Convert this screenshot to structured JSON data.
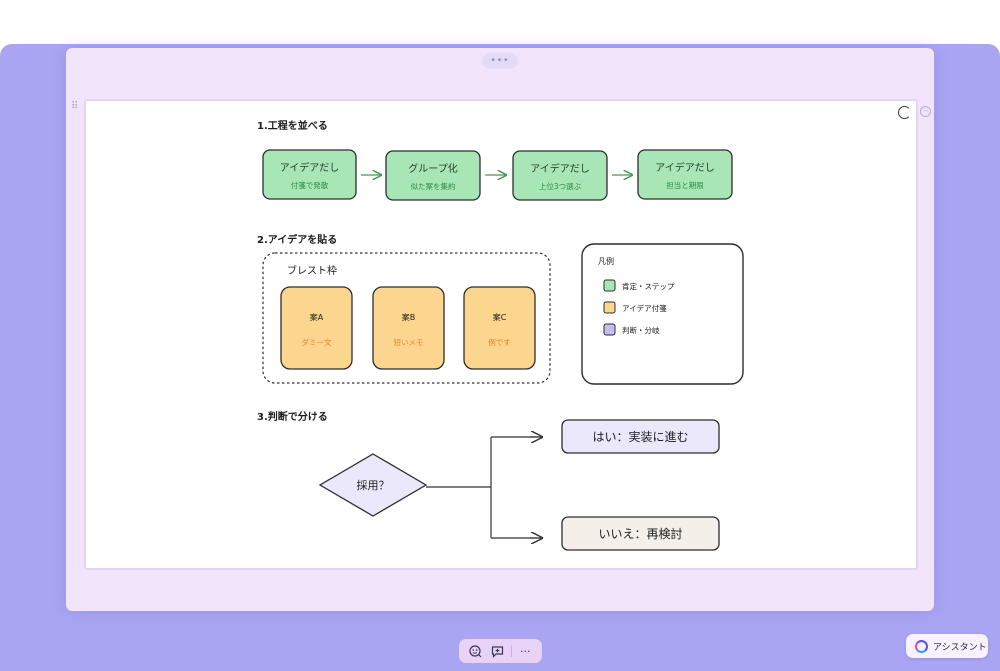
{
  "window": {
    "handle_dots": "•••"
  },
  "sections": {
    "s1": "1.工程を並べる",
    "s2": "2.アイデアを貼る",
    "s3": "3.判断で分ける"
  },
  "steps": [
    {
      "title": "アイデアだし",
      "sub": "付箋で発散"
    },
    {
      "title": "グループ化",
      "sub": "似た案を集約"
    },
    {
      "title": "アイデアだし",
      "sub": "上位3つ選ぶ"
    },
    {
      "title": "アイデアだし",
      "sub": "担当と期限"
    }
  ],
  "brainstorm": {
    "label": "ブレスト枠",
    "cards": [
      {
        "title": "案A",
        "sub": "ダミー文"
      },
      {
        "title": "案B",
        "sub": "短いメモ"
      },
      {
        "title": "案C",
        "sub": "例です"
      }
    ]
  },
  "legend": {
    "title": "凡例",
    "items": [
      {
        "label": "肯定・ステップ",
        "color": "#a8e6b6"
      },
      {
        "label": "アイデア付箋",
        "color": "#fcd68f"
      },
      {
        "label": "判断・分岐",
        "color": "#c3bdf2"
      }
    ]
  },
  "decision": {
    "question": "採用？",
    "yes": "はい：実装に進む",
    "no": "いいえ：再検討"
  },
  "colors": {
    "step_fill": "#a8e6b6",
    "step_text_sub": "#2f8a46",
    "note_fill": "#fcd68f",
    "note_sub": "#e8822a",
    "decision_fill": "#ebe8fb",
    "yes_fill": "#ebe8fb",
    "no_fill": "#f4efe8",
    "frame": "#a9a5f3"
  },
  "toolbar": {
    "comment_icon": "comment-icon",
    "add_comment_icon": "add-comment-icon",
    "more": "···"
  },
  "assistant": {
    "label": "アシスタント"
  }
}
